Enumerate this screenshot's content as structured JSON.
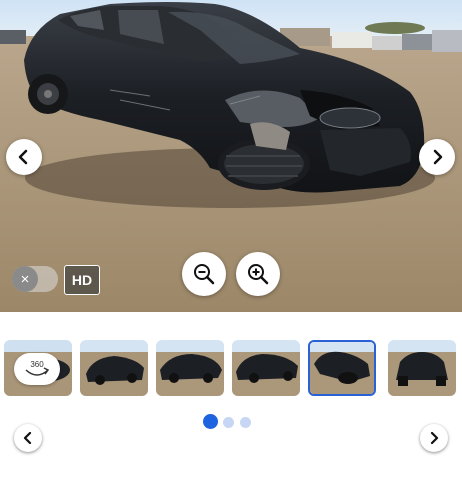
{
  "viewer": {
    "hd_label": "HD",
    "toggle_close_glyph": "×",
    "icons": [
      "chevron-left-icon",
      "chevron-right-icon",
      "zoom-out-icon",
      "zoom-in-icon",
      "close-icon"
    ]
  },
  "thumbnails": {
    "badge_360_label": "360",
    "count": 6,
    "selected_index": 4
  },
  "pagination": {
    "pages": 3,
    "active_page": 1
  },
  "colors": {
    "accent": "#1e63e0",
    "selected_border": "#2a62d6",
    "dot_inactive": "#c6d6f4",
    "car_body": "#1c1f24"
  }
}
